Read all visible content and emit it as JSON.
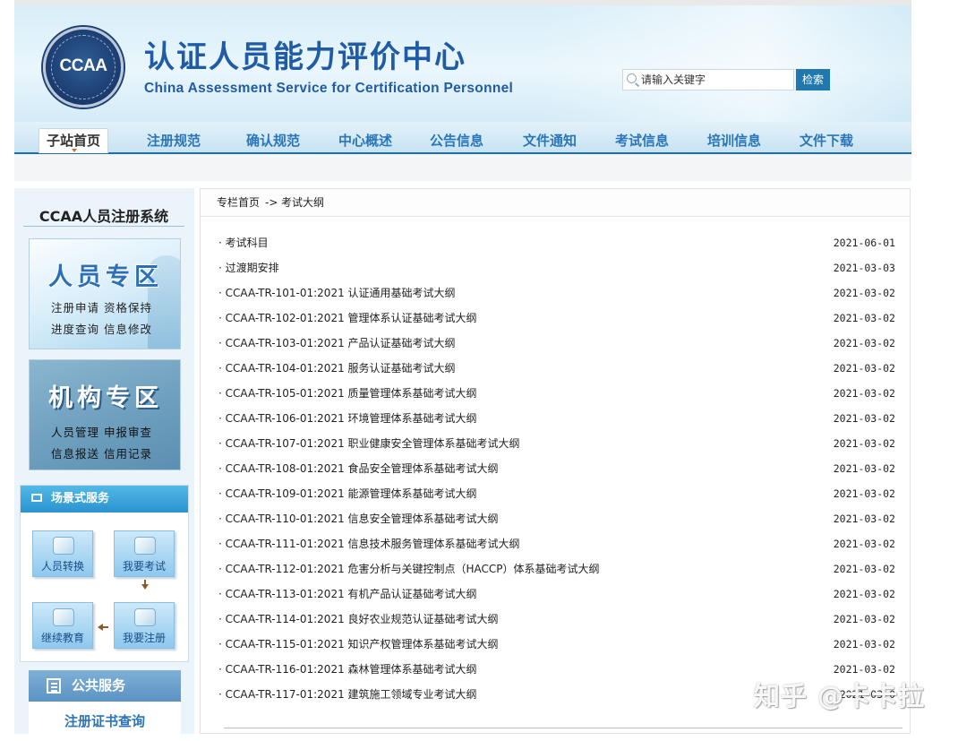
{
  "header": {
    "logo_text": "CCAA",
    "title_cn": "认证人员能力评价中心",
    "title_en": "China Assessment Service for Certification Personnel",
    "search_placeholder": "请输入关键字",
    "search_button": "检索"
  },
  "nav": {
    "items": [
      "子站首页",
      "注册规范",
      "确认规范",
      "中心概述",
      "公告信息",
      "文件通知",
      "考试信息",
      "培训信息",
      "文件下载"
    ]
  },
  "sidebar": {
    "system_title": "CCAA人员注册系统",
    "person_zone": {
      "title": "人员专区",
      "row1": "注册申请   资格保持",
      "row2": "进度查询   信息修改"
    },
    "org_zone": {
      "title": "机构专区",
      "row1": "人员管理   申报审查",
      "row2": "信息报送   信用记录"
    },
    "service": {
      "title": "场景式服务",
      "tiles": [
        "人员转换",
        "我要考试",
        "继续教育",
        "我要注册"
      ]
    },
    "public": {
      "title": "公共服务",
      "link": "注册证书查询"
    }
  },
  "breadcrumb": {
    "home": "专栏首页",
    "sep": "->",
    "current": "考试大纲"
  },
  "list": [
    {
      "title": "考试科目",
      "date": "2021-06-01"
    },
    {
      "title": "过渡期安排",
      "date": "2021-03-03"
    },
    {
      "title": "CCAA-TR-101-01:2021 认证通用基础考试大纲",
      "date": "2021-03-02"
    },
    {
      "title": "CCAA-TR-102-01:2021 管理体系认证基础考试大纲",
      "date": "2021-03-02"
    },
    {
      "title": "CCAA-TR-103-01:2021 产品认证基础考试大纲",
      "date": "2021-03-02"
    },
    {
      "title": "CCAA-TR-104-01:2021 服务认证基础考试大纲",
      "date": "2021-03-02"
    },
    {
      "title": "CCAA-TR-105-01:2021 质量管理体系基础考试大纲",
      "date": "2021-03-02"
    },
    {
      "title": "CCAA-TR-106-01:2021 环境管理体系基础考试大纲",
      "date": "2021-03-02"
    },
    {
      "title": "CCAA-TR-107-01:2021 职业健康安全管理体系基础考试大纲",
      "date": "2021-03-02"
    },
    {
      "title": "CCAA-TR-108-01:2021 食品安全管理体系基础考试大纲",
      "date": "2021-03-02"
    },
    {
      "title": "CCAA-TR-109-01:2021 能源管理体系基础考试大纲",
      "date": "2021-03-02"
    },
    {
      "title": "CCAA-TR-110-01:2021 信息安全管理体系基础考试大纲",
      "date": "2021-03-02"
    },
    {
      "title": "CCAA-TR-111-01:2021 信息技术服务管理体系基础考试大纲",
      "date": "2021-03-02"
    },
    {
      "title": "CCAA-TR-112-01:2021 危害分析与关键控制点（HACCP）体系基础考试大纲",
      "date": "2021-03-02"
    },
    {
      "title": "CCAA-TR-113-01:2021 有机产品认证基础考试大纲",
      "date": "2021-03-02"
    },
    {
      "title": "CCAA-TR-114-01:2021 良好农业规范认证基础考试大纲",
      "date": "2021-03-02"
    },
    {
      "title": "CCAA-TR-115-01:2021 知识产权管理体系基础考试大纲",
      "date": "2021-03-02"
    },
    {
      "title": "CCAA-TR-116-01:2021 森林管理体系基础考试大纲",
      "date": "2021-03-02"
    },
    {
      "title": "CCAA-TR-117-01:2021 建筑施工领域专业考试大纲",
      "date": "2021-03-0"
    }
  ],
  "watermark": "知乎 @卡卡拉",
  "colors": {
    "brand_blue": "#1f5ca5",
    "nav_text": "#2a76b8",
    "search_button": "#1f78b0",
    "service_header": "#2a93cf"
  }
}
